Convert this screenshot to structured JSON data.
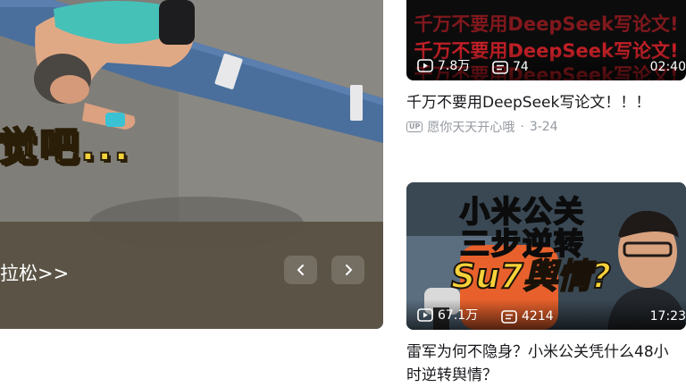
{
  "banner": {
    "overlay_text": "觉吧...",
    "title": "拉松>>"
  },
  "cards": [
    {
      "thumb_text": "千万不要用DeepSeek写论文!",
      "views": "7.8万",
      "danmaku": "74",
      "duration": "02:40",
      "title": "千万不要用DeepSeek写论文！！！",
      "up_badge": "UP",
      "author": "愿你天天开心哦",
      "date": "3-24"
    },
    {
      "thumb_line1": "小米公关",
      "thumb_line2": "三步逆转",
      "thumb_line3": "Su7舆情?",
      "views": "67.1万",
      "danmaku": "4214",
      "duration": "17:23",
      "title": "雷军为何不隐身？小米公关凭什么48小时逆转舆情？"
    }
  ],
  "colors": {
    "caption_bar": "#585042",
    "meta_gray": "#9499a0",
    "thumb_red": "#e0232b",
    "headline_yellow": "#f4d33b"
  }
}
